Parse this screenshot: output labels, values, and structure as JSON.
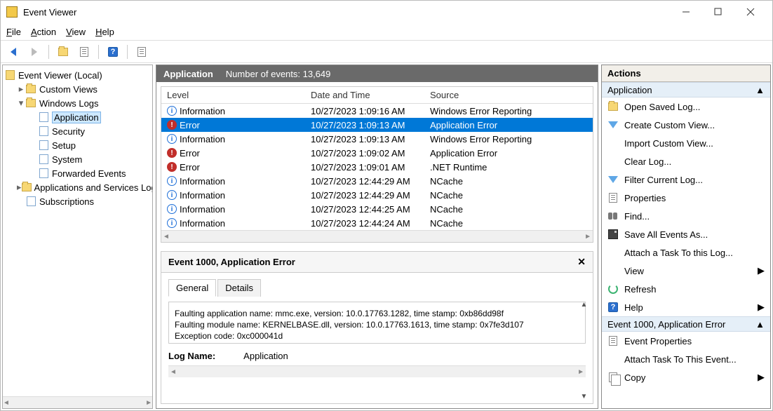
{
  "window": {
    "title": "Event Viewer"
  },
  "menu": [
    "File",
    "Action",
    "View",
    "Help"
  ],
  "tree": {
    "root": "Event Viewer (Local)",
    "items": [
      {
        "label": "Custom Views",
        "indent": 1,
        "expander": "▸",
        "icon": "folder"
      },
      {
        "label": "Windows Logs",
        "indent": 1,
        "expander": "▾",
        "icon": "folder"
      },
      {
        "label": "Application",
        "indent": 2,
        "expander": "",
        "icon": "log",
        "selected": true
      },
      {
        "label": "Security",
        "indent": 2,
        "expander": "",
        "icon": "log"
      },
      {
        "label": "Setup",
        "indent": 2,
        "expander": "",
        "icon": "log"
      },
      {
        "label": "System",
        "indent": 2,
        "expander": "",
        "icon": "log"
      },
      {
        "label": "Forwarded Events",
        "indent": 2,
        "expander": "",
        "icon": "log"
      },
      {
        "label": "Applications and Services Logs",
        "indent": 1,
        "expander": "▸",
        "icon": "folder"
      },
      {
        "label": "Subscriptions",
        "indent": 1,
        "expander": "",
        "icon": "sub"
      }
    ]
  },
  "center": {
    "heading": "Application",
    "count_label": "Number of events: 13,649",
    "columns": {
      "level": "Level",
      "date": "Date and Time",
      "source": "Source"
    },
    "events": [
      {
        "level": "Information",
        "lvl": "info",
        "date": "10/27/2023 1:09:16 AM",
        "source": "Windows Error Reporting"
      },
      {
        "level": "Error",
        "lvl": "error",
        "date": "10/27/2023 1:09:13 AM",
        "source": "Application Error",
        "selected": true
      },
      {
        "level": "Information",
        "lvl": "info",
        "date": "10/27/2023 1:09:13 AM",
        "source": "Windows Error Reporting"
      },
      {
        "level": "Error",
        "lvl": "error",
        "date": "10/27/2023 1:09:02 AM",
        "source": "Application Error"
      },
      {
        "level": "Error",
        "lvl": "error",
        "date": "10/27/2023 1:09:01 AM",
        "source": ".NET Runtime"
      },
      {
        "level": "Information",
        "lvl": "info",
        "date": "10/27/2023 12:44:29 AM",
        "source": "NCache"
      },
      {
        "level": "Information",
        "lvl": "info",
        "date": "10/27/2023 12:44:29 AM",
        "source": "NCache"
      },
      {
        "level": "Information",
        "lvl": "info",
        "date": "10/27/2023 12:44:25 AM",
        "source": "NCache"
      },
      {
        "level": "Information",
        "lvl": "info",
        "date": "10/27/2023 12:44:24 AM",
        "source": "NCache"
      }
    ]
  },
  "detail": {
    "title": "Event 1000, Application Error",
    "tabs": {
      "general": "General",
      "details": "Details"
    },
    "message": "Faulting application name: mmc.exe, version: 10.0.17763.1282, time stamp: 0xb86dd98f\nFaulting module name: KERNELBASE.dll, version: 10.0.17763.1613, time stamp: 0x7fe3d107\nException code: 0xc000041d",
    "logname_label": "Log Name:",
    "logname_value": "Application"
  },
  "actions": {
    "heading": "Actions",
    "section1": "Application",
    "items1": [
      {
        "label": "Open Saved Log...",
        "icon": "folder"
      },
      {
        "label": "Create Custom View...",
        "icon": "funnel"
      },
      {
        "label": "Import Custom View...",
        "icon": ""
      },
      {
        "label": "Clear Log...",
        "icon": ""
      },
      {
        "label": "Filter Current Log...",
        "icon": "funnel"
      },
      {
        "label": "Properties",
        "icon": "prop"
      },
      {
        "label": "Find...",
        "icon": "binoc"
      },
      {
        "label": "Save All Events As...",
        "icon": "disk"
      },
      {
        "label": "Attach a Task To this Log...",
        "icon": ""
      },
      {
        "label": "View",
        "icon": "",
        "sub": true
      },
      {
        "label": "Refresh",
        "icon": "refresh"
      },
      {
        "label": "Help",
        "icon": "help",
        "sub": true
      }
    ],
    "section2": "Event 1000, Application Error",
    "items2": [
      {
        "label": "Event Properties",
        "icon": "prop"
      },
      {
        "label": "Attach Task To This Event...",
        "icon": ""
      },
      {
        "label": "Copy",
        "icon": "copy",
        "sub": true
      }
    ]
  }
}
